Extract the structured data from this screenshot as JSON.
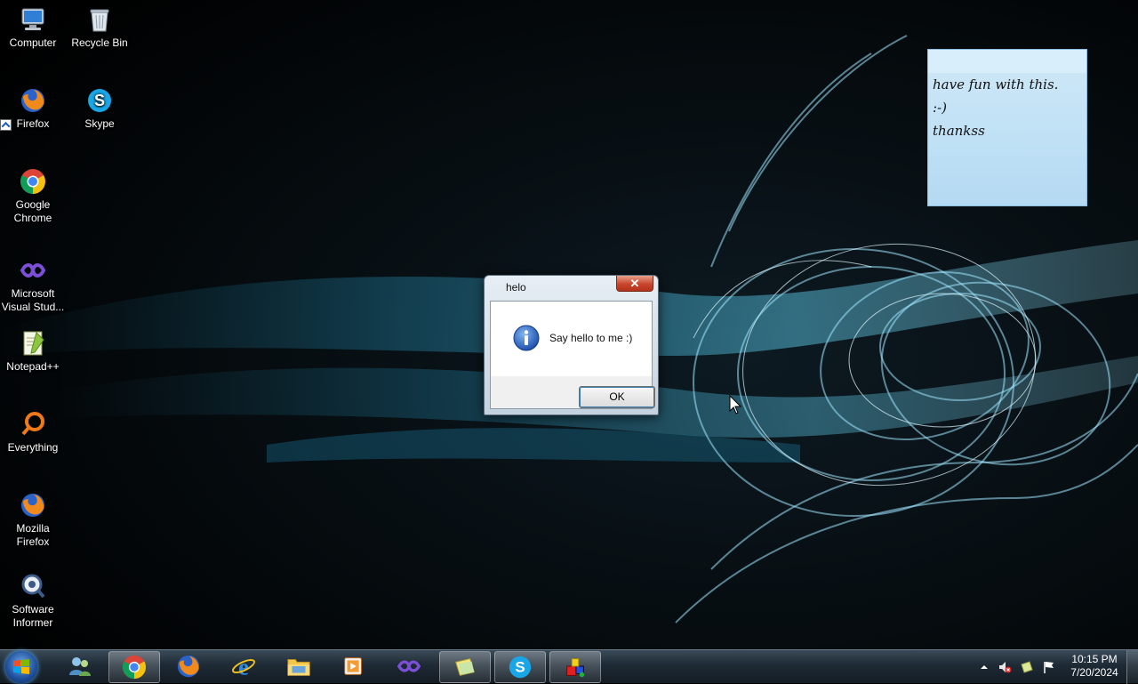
{
  "desktop": {
    "icons": [
      {
        "label": "Computer",
        "icon": "computer-icon"
      },
      {
        "label": "Recycle Bin",
        "icon": "recycle-bin-icon"
      },
      {
        "label": "Firefox",
        "icon": "firefox-icon"
      },
      {
        "label": "Skype",
        "icon": "skype-icon"
      },
      {
        "label": "Google Chrome",
        "icon": "chrome-icon"
      },
      {
        "label": "Microsoft Visual Stud...",
        "icon": "visual-studio-icon"
      },
      {
        "label": "Notepad++",
        "icon": "notepadpp-icon"
      },
      {
        "label": "Everything",
        "icon": "everything-icon"
      },
      {
        "label": "Mozilla Firefox",
        "icon": "firefox-icon"
      },
      {
        "label": "Software Informer",
        "icon": "software-informer-icon"
      }
    ]
  },
  "sticky_note": {
    "lines": [
      "have fun with this.",
      ":-)",
      "thankss"
    ],
    "color": "#c4e3f6"
  },
  "dialog": {
    "title": "helo",
    "close_label": "✕",
    "message": "Say hello to me :)",
    "icon": "info-icon",
    "ok_label": "OK"
  },
  "taskbar": {
    "pinned": [
      {
        "name": "chrome",
        "icon": "chrome-icon",
        "open": true
      },
      {
        "name": "firefox",
        "icon": "firefox-icon",
        "open": false
      },
      {
        "name": "internet-explorer",
        "icon": "ie-icon",
        "open": false
      },
      {
        "name": "explorer",
        "icon": "folder-icon",
        "open": false
      },
      {
        "name": "media-player",
        "icon": "media-player-icon",
        "open": false
      },
      {
        "name": "visual-studio",
        "icon": "visual-studio-icon",
        "open": false
      },
      {
        "name": "sticky-notes",
        "icon": "sticky-notes-icon",
        "open": true
      },
      {
        "name": "skype",
        "icon": "skype-icon",
        "open": true
      },
      {
        "name": "app",
        "icon": "app-blocks-icon",
        "open": true
      }
    ],
    "clock": {
      "time": "10:15 PM",
      "date": "7/20/2024"
    },
    "tray_icons": [
      "show-hidden-icon",
      "speaker-muted-icon",
      "network-icon",
      "action-center-flag-icon"
    ]
  }
}
